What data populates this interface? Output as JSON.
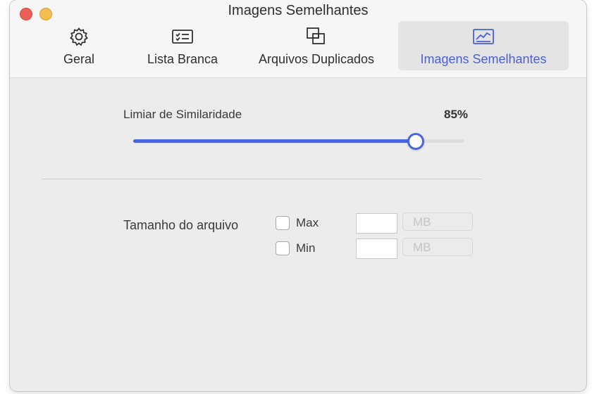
{
  "window": {
    "title": "Imagens Semelhantes",
    "colors": {
      "close": "#ec5f57",
      "minimize": "#f3bd4f",
      "accent": "#4a65e0"
    }
  },
  "tabs": [
    {
      "label": "Geral",
      "icon": "gear-icon",
      "active": false
    },
    {
      "label": "Lista Branca",
      "icon": "checklist-icon",
      "active": false
    },
    {
      "label": "Arquivos Duplicados",
      "icon": "duplicate-files-icon",
      "active": false
    },
    {
      "label": "Imagens Semelhantes",
      "icon": "image-chart-icon",
      "active": true
    }
  ],
  "similarity": {
    "label": "Limiar de Similaridade",
    "value_text": "85%",
    "value": 0.85
  },
  "file_size": {
    "label": "Tamanho do arquivo",
    "max": {
      "label": "Max",
      "value": "",
      "unit": "MB",
      "checked": false
    },
    "min": {
      "label": "Min",
      "value": "",
      "unit": "MB",
      "checked": false
    }
  }
}
